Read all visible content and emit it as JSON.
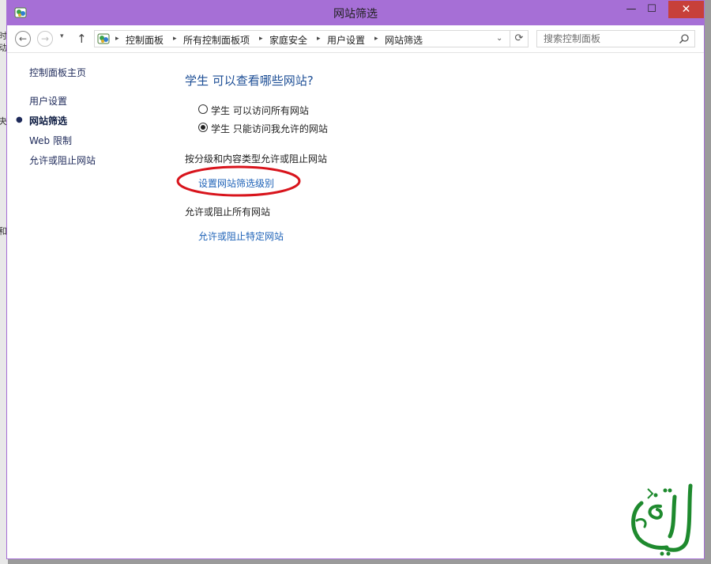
{
  "window": {
    "title": "网站筛选",
    "min_glyph": "—",
    "max_glyph": "☐",
    "close_glyph": "✕"
  },
  "nav": {
    "back_glyph": "←",
    "forward_glyph": "→",
    "dropdown_glyph": "▾",
    "up_glyph": "↑",
    "breadcrumbs": [
      "控制面板",
      "所有控制面板项",
      "家庭安全",
      "用户设置",
      "网站筛选"
    ],
    "separator_glyph": "▸",
    "address_dropdown_glyph": "⌄",
    "refresh_glyph": "⟳",
    "search_placeholder": "搜索控制面板"
  },
  "sidebar": {
    "home": "控制面板主页",
    "items": [
      {
        "label": "用户设置",
        "active": false
      },
      {
        "label": "网站筛选",
        "active": true
      },
      {
        "label": "Web 限制",
        "active": false
      },
      {
        "label": "允许或阻止网站",
        "active": false
      }
    ]
  },
  "main": {
    "heading": "学生 可以查看哪些网站?",
    "options": [
      {
        "label": "学生 可以访问所有网站",
        "selected": false
      },
      {
        "label": "学生 只能访问我允许的网站",
        "selected": true
      }
    ],
    "rating_section_label": "按分级和内容类型允许或阻止网站",
    "rating_link": "设置网站筛选级别",
    "all_section_label": "允许或阻止所有网站",
    "specific_link": "允许或阻止特定网站"
  },
  "background_fragments": [
    "时",
    "动",
    "夬",
    "和"
  ],
  "colors": {
    "titlebar": "#a66fd6",
    "close": "#c7403a",
    "link": "#2164b8",
    "heading": "#1e4f96",
    "highlight_ellipse": "#d8141c",
    "watermark": "#1e8a2e"
  },
  "icons": {
    "app": "control-panel-icon",
    "search": "search-icon",
    "watermark": "arabic-calligraphy-logo"
  }
}
